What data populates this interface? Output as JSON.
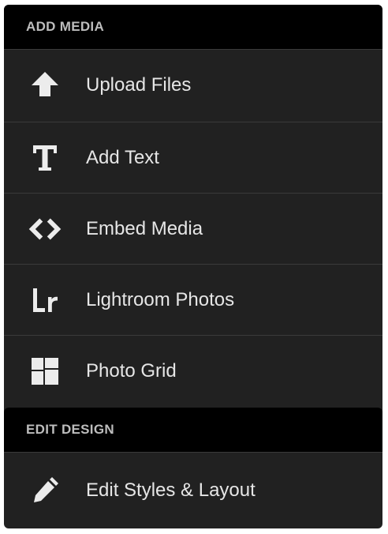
{
  "sections": [
    {
      "header": "ADD MEDIA",
      "items": [
        {
          "label": "Upload Files",
          "icon": "upload-arrow-icon"
        },
        {
          "label": "Add Text",
          "icon": "text-t-icon"
        },
        {
          "label": "Embed Media",
          "icon": "code-brackets-icon"
        },
        {
          "label": "Lightroom Photos",
          "icon": "lightroom-icon"
        },
        {
          "label": "Photo Grid",
          "icon": "grid-icon"
        }
      ]
    },
    {
      "header": "EDIT DESIGN",
      "items": [
        {
          "label": "Edit Styles & Layout",
          "icon": "pencil-icon"
        }
      ]
    }
  ],
  "colors": {
    "panel_bg": "#212121",
    "header_bg": "#000000",
    "header_text": "#bdbdbd",
    "item_text": "#e6e6e6",
    "divider": "#3a3a3a",
    "icon": "#ececec"
  }
}
